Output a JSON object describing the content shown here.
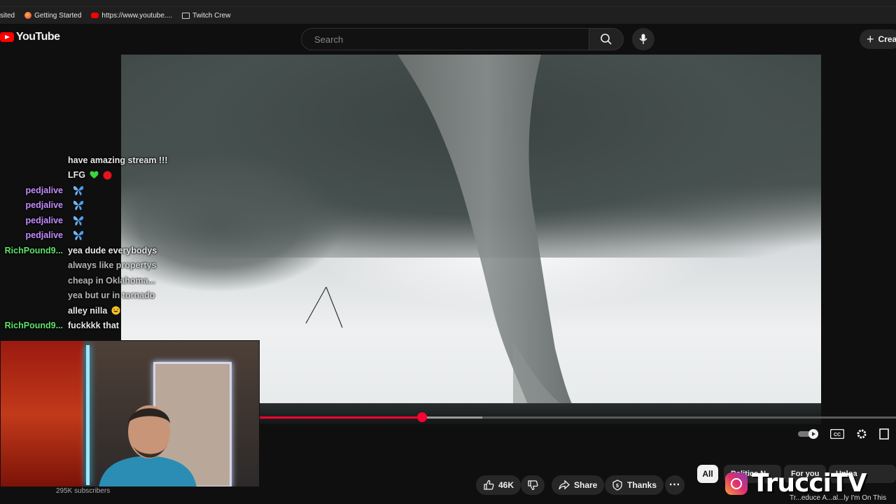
{
  "bookmarks": [
    {
      "label": "sited",
      "icon": "none"
    },
    {
      "label": "Getting Started",
      "icon": "firefox-icon"
    },
    {
      "label": "https://www.youtube....",
      "icon": "youtube-icon"
    },
    {
      "label": "Twitch Crew",
      "icon": "folder-icon"
    }
  ],
  "header": {
    "logo": "YouTube",
    "search_placeholder": "Search",
    "create_label": "Crea"
  },
  "player": {
    "progress": 0.26,
    "buffered": 0.35,
    "accent": "#ff0033"
  },
  "chat": [
    {
      "user": "",
      "text": "have amazing stream !!!",
      "color": "#e8e8e8",
      "emotes": []
    },
    {
      "user": "",
      "text": "LFG",
      "color": "#e8e8e8",
      "emotes": [
        "green-heart",
        "red-circle"
      ]
    },
    {
      "user": "pedjalive",
      "text": "",
      "color": "#c58cff",
      "emotes": [
        "blue-butterfly"
      ]
    },
    {
      "user": "pedjalive",
      "text": "",
      "color": "#c58cff",
      "emotes": [
        "blue-butterfly"
      ]
    },
    {
      "user": "pedjalive",
      "text": "",
      "color": "#c58cff",
      "emotes": [
        "blue-butterfly"
      ]
    },
    {
      "user": "pedjalive",
      "text": "",
      "color": "#c58cff",
      "emotes": [
        "blue-butterfly"
      ]
    },
    {
      "user": "RichPound9...",
      "text": "yea dude everybodys",
      "color": "#5fe36a",
      "emotes": []
    },
    {
      "user": "",
      "text": "always like propertys",
      "color": "#e8e8e8",
      "emotes": []
    },
    {
      "user": "",
      "text": "cheap in Oklahoma...",
      "color": "#e8e8e8",
      "emotes": []
    },
    {
      "user": "",
      "text": "yea but ur in tornado",
      "color": "#e8e8e8",
      "emotes": []
    },
    {
      "user": "",
      "text": "alley nilla",
      "color": "#e8e8e8",
      "emotes": [
        "laughing-face"
      ]
    },
    {
      "user": "RichPound9...",
      "text": "fuckkkk that",
      "color": "#5fe36a",
      "emotes": []
    }
  ],
  "channel": {
    "subscribers": "295K subscribers"
  },
  "actions": {
    "likes": "46K",
    "share": "Share",
    "thanks": "Thanks"
  },
  "chips": {
    "all": "All",
    "politics": "Politics N",
    "for_you": "For you",
    "uploads": "Uploa"
  },
  "watermark": "TrucciTV",
  "next_video_title": "Tr...educe A...al...ly I'm On This"
}
